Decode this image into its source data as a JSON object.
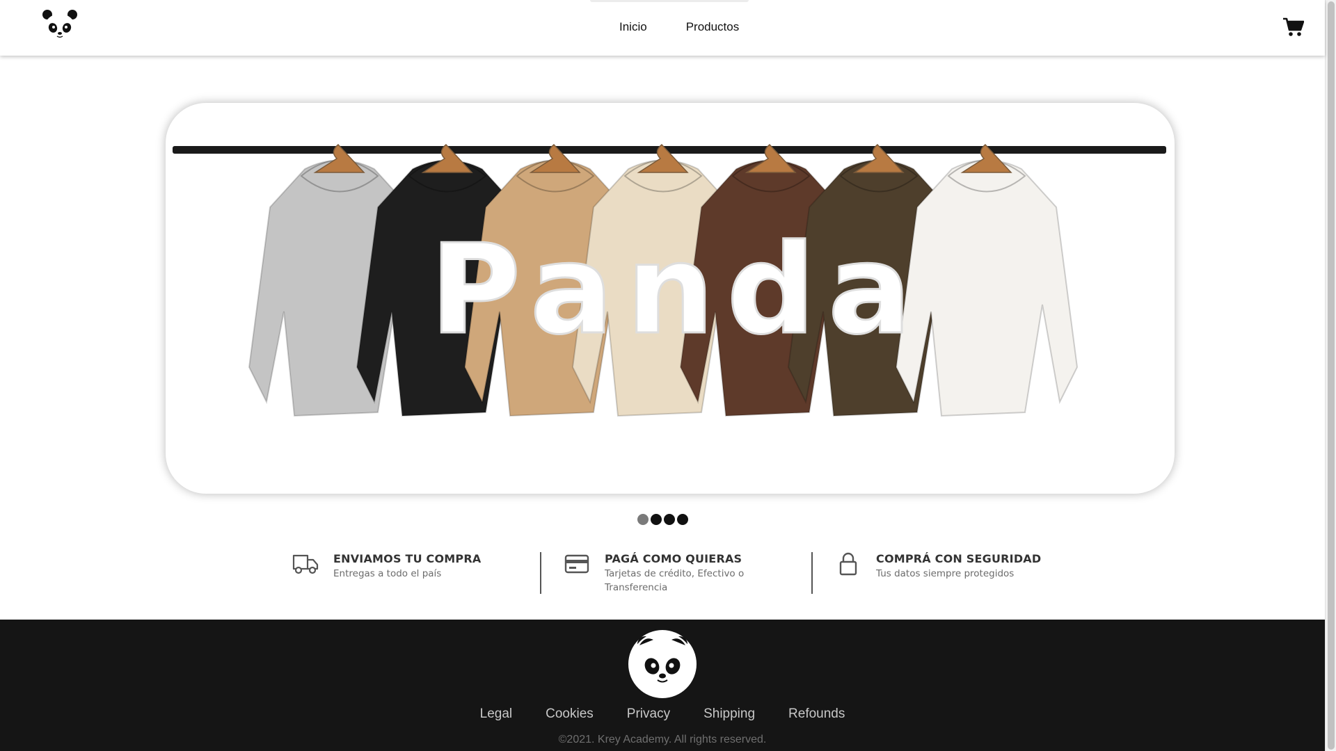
{
  "header": {
    "logo_icon": "panda-face-icon",
    "nav": [
      "Inicio",
      "Productos"
    ],
    "cart_icon": "shopping-cart-icon"
  },
  "hero": {
    "banner_text": "Panda",
    "slide_count": 4,
    "active_slide": 1,
    "hoodie_colors": [
      "#c4c4c4",
      "#1e1e1e",
      "#cfa77a",
      "#eadcc4",
      "#5e3a2a",
      "#4e3f2c",
      "#f4f2ee"
    ]
  },
  "features": [
    {
      "icon": "truck-icon",
      "title": "ENVIAMOS TU COMPRA",
      "subtitle": "Entregas a todo el país"
    },
    {
      "icon": "credit-card-icon",
      "title": "PAGÁ COMO QUIERAS",
      "subtitle": "Tarjetas de crédito, Efectivo o Transferencia"
    },
    {
      "icon": "lock-icon",
      "title": "COMPRÁ CON SEGURIDAD",
      "subtitle": "Tus datos siempre protegidos"
    }
  ],
  "footer": {
    "logo_icon": "panda-face-icon",
    "links": [
      "Legal",
      "Cookies",
      "Privacy",
      "Shipping",
      "Refounds"
    ],
    "copyright": "©2021. Krey Academy. All rights reserved."
  }
}
